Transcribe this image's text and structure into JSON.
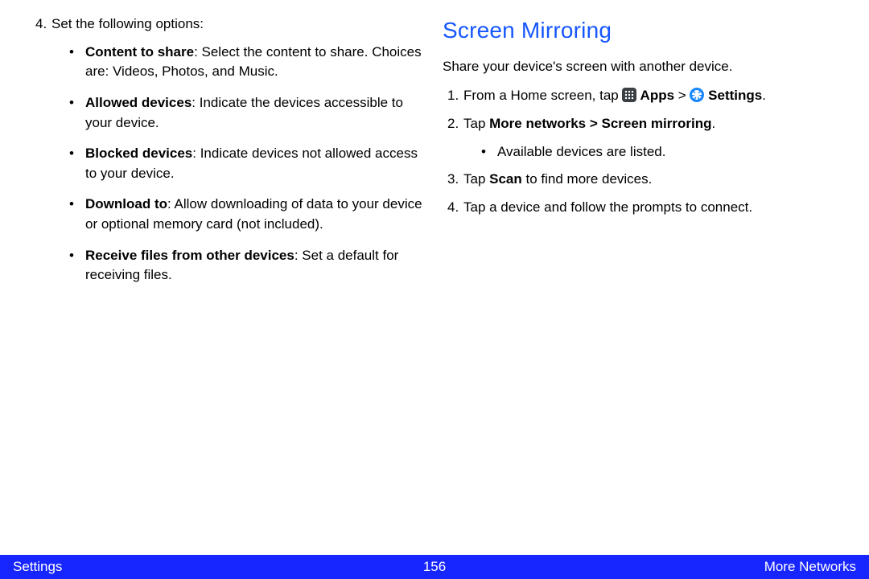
{
  "left": {
    "step4_lead": "Set the following options:",
    "bullets": [
      {
        "bold": "Content to share",
        "text": ": Select the content to share. Choices are: Videos, Photos, and Music."
      },
      {
        "bold": "Allowed devices",
        "text": ": Indicate the devices accessible to your device."
      },
      {
        "bold": "Blocked devices",
        "text": ": Indicate devices not allowed access to your device."
      },
      {
        "bold": "Download to",
        "text": ": Allow downloading of data to your device or optional memory card (not included)."
      },
      {
        "bold": "Receive files from other devices",
        "text": ": Set a default for receiving files."
      }
    ]
  },
  "right": {
    "heading": "Screen Mirroring",
    "intro": "Share your device's screen with another device.",
    "step1_pre": "From a Home screen, tap ",
    "step1_apps": " Apps",
    "step1_sep": " > ",
    "step1_settings": " Settings",
    "step1_end": ".",
    "step2_pre": "Tap ",
    "step2_bold": "More networks > Screen mirroring",
    "step2_end": ".",
    "step2_sub": "Available devices are listed.",
    "step3_pre": "Tap ",
    "step3_bold": "Scan",
    "step3_post": " to find more devices.",
    "step4": "Tap a device and follow the prompts to connect."
  },
  "footer": {
    "left": "Settings",
    "page": "156",
    "right": "More Networks"
  },
  "nums": {
    "n1": "1.",
    "n2": "2.",
    "n3": "3.",
    "n4": "4."
  },
  "dot": "•"
}
